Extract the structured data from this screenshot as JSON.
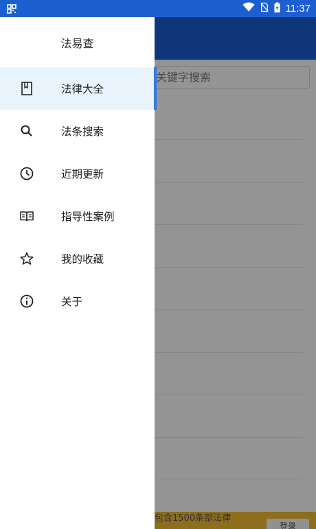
{
  "status_bar": {
    "time": "11:37"
  },
  "drawer": {
    "title": "法易查",
    "items": [
      {
        "label": "法律大全",
        "icon": "book-icon",
        "active": true
      },
      {
        "label": "法条搜索",
        "icon": "search-icon",
        "active": false
      },
      {
        "label": "近期更新",
        "icon": "clock-icon",
        "active": false
      },
      {
        "label": "指导性案例",
        "icon": "open-book-icon",
        "active": false
      },
      {
        "label": "我的收藏",
        "icon": "star-icon",
        "active": false
      },
      {
        "label": "关于",
        "icon": "info-icon",
        "active": false
      }
    ]
  },
  "background": {
    "search_placeholder": "关键字搜索",
    "banner_text": "包含1500条部法律",
    "banner_button": "登录"
  },
  "colors": {
    "primary": "#1a5ed2",
    "active_item_bg": "#e8f3fb",
    "active_indicator": "#2f7be6",
    "banner": "#f3be34"
  }
}
